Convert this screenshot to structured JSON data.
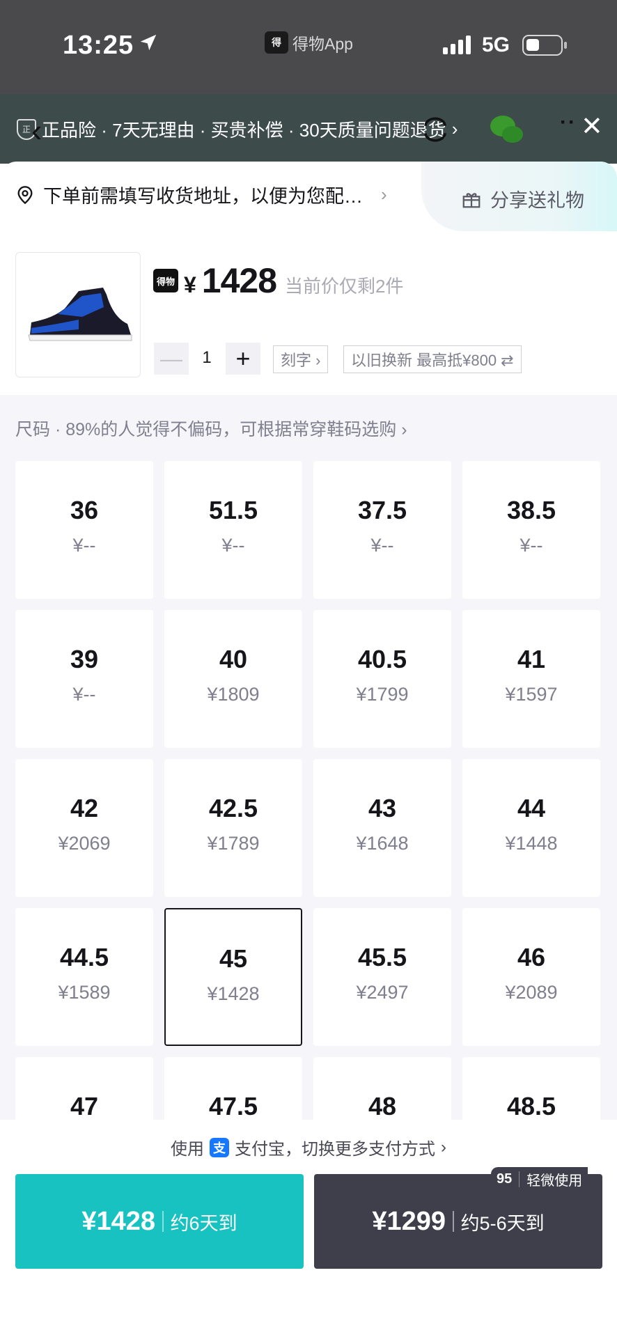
{
  "status": {
    "time": "13:25",
    "app_name": "得物App",
    "network": "5G"
  },
  "nav": {
    "guarantees": "正品险 · 7天无理由 · 买贵补偿 · 30天质量问题退货",
    "shield_glyph": "正",
    "chevron": "›",
    "back": "‹",
    "more": "··",
    "close": "✕"
  },
  "address": {
    "text": "下单前需填写收货地址，以便为您配…",
    "chevron": "›"
  },
  "share": {
    "label": "分享送礼物"
  },
  "product": {
    "logo_text": "得物",
    "currency": "¥",
    "price": "1428",
    "price_note": "当前价仅剩2件",
    "quantity": "1",
    "minus": "—",
    "plus": "+",
    "engrave_label": "刻字 ›",
    "tradein_label": "以旧换新 最高抵¥800 ⇄"
  },
  "size_section": {
    "label": "尺码",
    "hint": "89%的人觉得不偏码，可根据常穿鞋码选购",
    "chevron": "›",
    "sizes": [
      {
        "size": "36",
        "price": "¥--"
      },
      {
        "size": "51.5",
        "price": "¥--"
      },
      {
        "size": "37.5",
        "price": "¥--"
      },
      {
        "size": "38.5",
        "price": "¥--"
      },
      {
        "size": "39",
        "price": "¥--"
      },
      {
        "size": "40",
        "price": "¥1809"
      },
      {
        "size": "40.5",
        "price": "¥1799"
      },
      {
        "size": "41",
        "price": "¥1597"
      },
      {
        "size": "42",
        "price": "¥2069"
      },
      {
        "size": "42.5",
        "price": "¥1789"
      },
      {
        "size": "43",
        "price": "¥1648"
      },
      {
        "size": "44",
        "price": "¥1448"
      },
      {
        "size": "44.5",
        "price": "¥1589"
      },
      {
        "size": "45",
        "price": "¥1428"
      },
      {
        "size": "45.5",
        "price": "¥2497"
      },
      {
        "size": "46",
        "price": "¥2089"
      },
      {
        "size": "47",
        "price": ""
      },
      {
        "size": "47.5",
        "price": ""
      },
      {
        "size": "48",
        "price": ""
      },
      {
        "size": "48.5",
        "price": ""
      }
    ],
    "selected": "45"
  },
  "payment": {
    "prefix": "使用",
    "method": "支付宝，切换更多支付方式",
    "alipay_glyph": "支",
    "chevron": "›"
  },
  "buttons": {
    "left_price": "¥1428",
    "left_delivery": "约6天到",
    "right_price": "¥1299",
    "right_delivery": "约5-6天到",
    "badge_grade": "95",
    "badge_text": "轻微使用"
  },
  "colors": {
    "accent": "#18c2c0",
    "dark_button": "#3f3f4c",
    "alipay": "#1677ff"
  }
}
